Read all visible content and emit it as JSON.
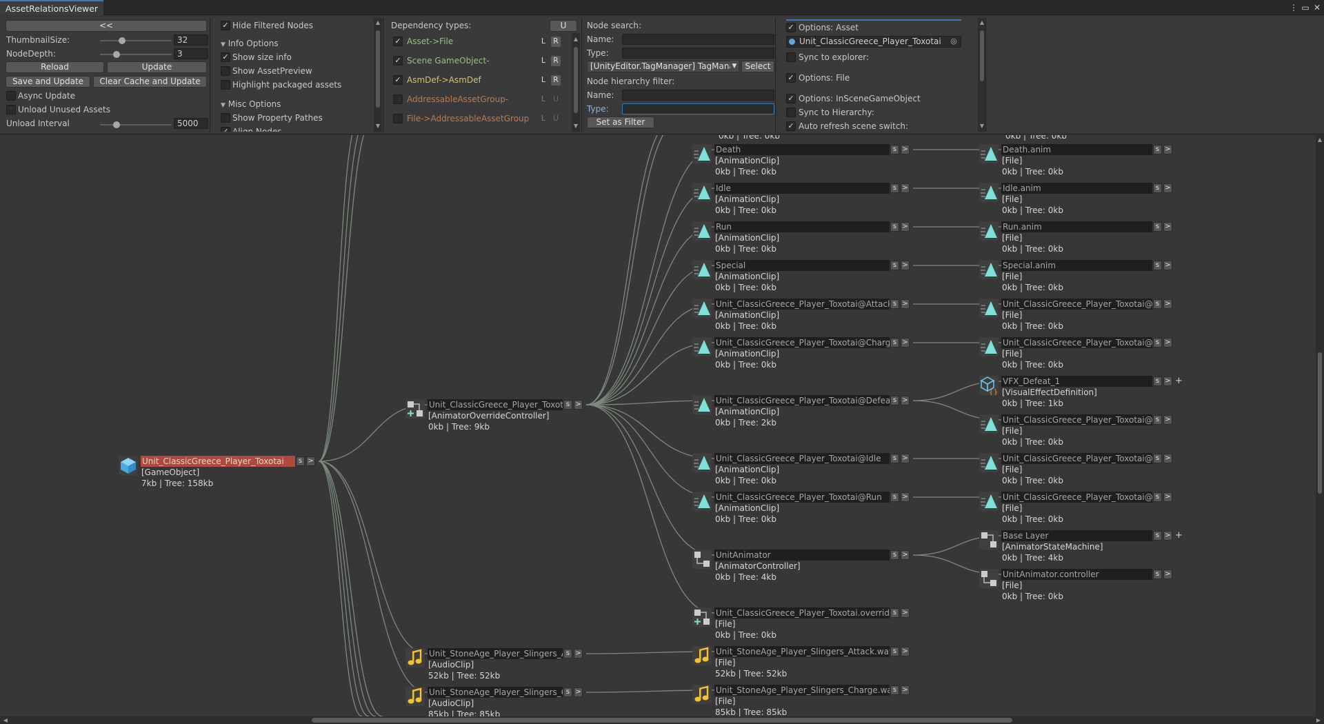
{
  "window": {
    "title": "AssetRelationsViewer",
    "controls": [
      "⋮",
      "▭",
      "✕"
    ]
  },
  "p1": {
    "collapse_label": "<<",
    "thumb_label": "ThumbnailSize:",
    "thumb_value": "32",
    "depth_label": "NodeDepth:",
    "depth_value": "3",
    "reload": "Reload",
    "update": "Update",
    "save_update": "Save and Update",
    "clear_update": "Clear Cache and Update",
    "async": "Async Update",
    "unload_unused": "Unload Unused Assets",
    "unload_interval_label": "Unload Interval",
    "unload_interval_value": "5000"
  },
  "p2": {
    "hide_filtered": "Hide Filtered Nodes",
    "info_options": "Info Options",
    "show_size": "Show size info",
    "show_preview": "Show AssetPreview",
    "highlight": "Highlight packaged assets",
    "misc_options": "Misc Options",
    "show_paths": "Show Property Pathes",
    "align_nodes": "Align Nodes"
  },
  "p3": {
    "title": "Dependency types:",
    "u_btn": "U",
    "deps": [
      {
        "label": "Asset->File",
        "checked": true,
        "color": "#9bc17a",
        "l": "L",
        "r": "R"
      },
      {
        "label": "Scene GameObject->GameObject",
        "checked": true,
        "color": "#9bc17a",
        "l": "L",
        "r": "R"
      },
      {
        "label": "AsmDef->AsmDef",
        "checked": true,
        "color": "#d6c46a",
        "l": "L",
        "r": "R"
      },
      {
        "label": "AddressableAssetGroup->Asset",
        "checked": false,
        "color": "#c0794a",
        "l": "L",
        "r": "U"
      },
      {
        "label": "File->AddressableAssetGroup",
        "checked": false,
        "color": "#c0794a",
        "l": "L",
        "r": "U"
      }
    ]
  },
  "p4": {
    "search_label": "Node search:",
    "name_label": "Name:",
    "type_label": "Type:",
    "name_value": "",
    "type_value": "",
    "dropdown_value": "[UnityEditor.TagManager] TagManager",
    "select_btn": "Select",
    "hier_label": "Node hierarchy filter:",
    "hier_name_label": "Name:",
    "hier_type_label": "Type:",
    "hier_name_value": "",
    "hier_type_value": "",
    "set_filter": "Set as Filter"
  },
  "p5": {
    "opt_asset": "Options: Asset",
    "asset_field": "Unit_ClassicGreece_Player_Toxotai",
    "sync_explorer": "Sync to explorer:",
    "opt_file": "Options: File",
    "opt_scene": "Options: InSceneGameObject",
    "sync_hier": "Sync to Hierarchy:",
    "auto_refresh": "Auto refresh scene switch:"
  },
  "node_buttons": {
    "s": "s",
    "arrow": ">",
    "plus": "+"
  },
  "partial_top": {
    "text": "0kb | Tree: 0kb"
  },
  "nodes": [
    {
      "id": "root",
      "name": "Unit_ClassicGreece_Player_Toxotai",
      "type": "[GameObject]",
      "size": "7kb | Tree: 158kb",
      "icon": "cube-icon",
      "selected": true
    },
    {
      "id": "aoc",
      "name": "Unit_ClassicGreece_Player_Toxotai",
      "type": "[AnimatorOverrideController]",
      "size": "0kb | Tree: 9kb",
      "icon": "override-controller-icon"
    },
    {
      "id": "sa1",
      "name": "Unit_StoneAge_Player_Slingers_Attack",
      "type": "[AudioClip]",
      "size": "52kb | Tree: 52kb",
      "icon": "audio-clip-icon"
    },
    {
      "id": "sa2",
      "name": "Unit_StoneAge_Player_Slingers_Charge",
      "type": "[AudioClip]",
      "size": "85kb | Tree: 85kb",
      "icon": "audio-clip-icon"
    },
    {
      "id": "c1",
      "name": "Death",
      "type": "[AnimationClip]",
      "size": "0kb | Tree: 0kb",
      "icon": "animation-clip-icon"
    },
    {
      "id": "c2",
      "name": "Idle",
      "type": "[AnimationClip]",
      "size": "0kb | Tree: 0kb",
      "icon": "animation-clip-icon"
    },
    {
      "id": "c3",
      "name": "Run",
      "type": "[AnimationClip]",
      "size": "0kb | Tree: 0kb",
      "icon": "animation-clip-icon"
    },
    {
      "id": "c4",
      "name": "Special",
      "type": "[AnimationClip]",
      "size": "0kb | Tree: 0kb",
      "icon": "animation-clip-icon"
    },
    {
      "id": "c5",
      "name": "Unit_ClassicGreece_Player_Toxotai@Attack",
      "type": "[AnimationClip]",
      "size": "0kb | Tree: 0kb",
      "icon": "animation-clip-icon"
    },
    {
      "id": "c6",
      "name": "Unit_ClassicGreece_Player_Toxotai@Charge",
      "type": "[AnimationClip]",
      "size": "0kb | Tree: 0kb",
      "icon": "animation-clip-icon"
    },
    {
      "id": "c7",
      "name": "Unit_ClassicGreece_Player_Toxotai@Defeat",
      "type": "[AnimationClip]",
      "size": "0kb | Tree: 2kb",
      "icon": "animation-clip-icon"
    },
    {
      "id": "c8",
      "name": "Unit_ClassicGreece_Player_Toxotai@Idle",
      "type": "[AnimationClip]",
      "size": "0kb | Tree: 0kb",
      "icon": "animation-clip-icon"
    },
    {
      "id": "c9",
      "name": "Unit_ClassicGreece_Player_Toxotai@Run",
      "type": "[AnimationClip]",
      "size": "0kb | Tree: 0kb",
      "icon": "animation-clip-icon"
    },
    {
      "id": "c10",
      "name": "UnitAnimator",
      "type": "[AnimatorController]",
      "size": "0kb | Tree: 4kb",
      "icon": "animator-controller-icon"
    },
    {
      "id": "c11",
      "name": "Unit_ClassicGreece_Player_Toxotai.overrideController",
      "type": "[File]",
      "size": "0kb | Tree: 0kb",
      "icon": "override-controller-icon"
    },
    {
      "id": "c12",
      "name": "Unit_StoneAge_Player_Slingers_Attack.wav",
      "type": "[File]",
      "size": "52kb | Tree: 52kb",
      "icon": "audio-clip-icon"
    },
    {
      "id": "c13",
      "name": "Unit_StoneAge_Player_Slingers_Charge.wav",
      "type": "[File]",
      "size": "85kb | Tree: 85kb",
      "icon": "audio-clip-icon"
    },
    {
      "id": "f1",
      "name": "Death.anim",
      "type": "[File]",
      "size": "0kb | Tree: 0kb",
      "icon": "animation-clip-icon"
    },
    {
      "id": "f2",
      "name": "Idle.anim",
      "type": "[File]",
      "size": "0kb | Tree: 0kb",
      "icon": "animation-clip-icon"
    },
    {
      "id": "f3",
      "name": "Run.anim",
      "type": "[File]",
      "size": "0kb | Tree: 0kb",
      "icon": "animation-clip-icon"
    },
    {
      "id": "f4",
      "name": "Special.anim",
      "type": "[File]",
      "size": "0kb | Tree: 0kb",
      "icon": "animation-clip-icon"
    },
    {
      "id": "f5",
      "name": "Unit_ClassicGreece_Player_Toxotai@Attack.anim",
      "type": "[File]",
      "size": "0kb | Tree: 0kb",
      "icon": "animation-clip-icon"
    },
    {
      "id": "f6",
      "name": "Unit_ClassicGreece_Player_Toxotai@Charge.anim",
      "type": "[File]",
      "size": "0kb | Tree: 0kb",
      "icon": "animation-clip-icon"
    },
    {
      "id": "f7",
      "name": "VFX_Defeat_1",
      "type": "[VisualEffectDefinition]",
      "size": "0kb | Tree: 1kb",
      "icon": "visual-effect-icon",
      "plus": true
    },
    {
      "id": "f8",
      "name": "Unit_ClassicGreece_Player_Toxotai@Defeat.anim",
      "type": "[File]",
      "size": "0kb | Tree: 0kb",
      "icon": "animation-clip-icon"
    },
    {
      "id": "f9",
      "name": "Unit_ClassicGreece_Player_Toxotai@Idle.anim",
      "type": "[File]",
      "size": "0kb | Tree: 0kb",
      "icon": "animation-clip-icon"
    },
    {
      "id": "f10",
      "name": "Unit_ClassicGreece_Player_Toxotai@Run.anim",
      "type": "[File]",
      "size": "0kb | Tree: 0kb",
      "icon": "animation-clip-icon"
    },
    {
      "id": "f11",
      "name": "Base Layer",
      "type": "[AnimatorStateMachine]",
      "size": "0kb | Tree: 4kb",
      "icon": "state-machine-icon",
      "plus": true
    },
    {
      "id": "f12",
      "name": "UnitAnimator.controller",
      "type": "[File]",
      "size": "0kb | Tree: 0kb",
      "icon": "animator-controller-icon"
    }
  ]
}
